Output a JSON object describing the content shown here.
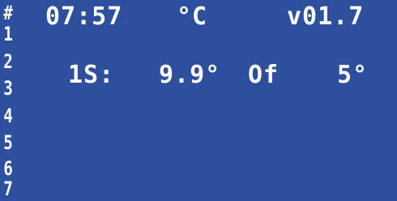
{
  "header": {
    "hash": "#",
    "time": "07:57",
    "unit": "°C",
    "version": "v01.7"
  },
  "gutter": [
    "1",
    "2",
    "3",
    "4",
    "5",
    "6",
    "7"
  ],
  "rows": [
    {
      "id": "1S:",
      "temperature": "9.9°",
      "state": "Of",
      "setpoint": "5°"
    }
  ]
}
